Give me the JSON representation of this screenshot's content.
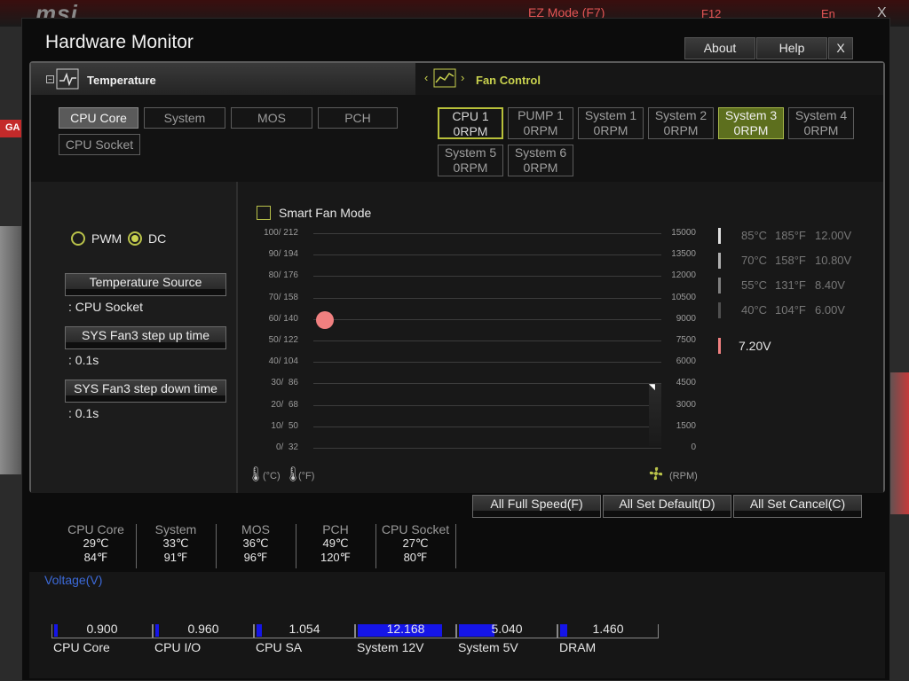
{
  "background": {
    "logo": "msi",
    "ez_mode": "EZ Mode (F7)",
    "f12": "F12",
    "language": "En",
    "close": "X",
    "side_tab": "GA"
  },
  "window": {
    "title": "Hardware Monitor",
    "buttons": {
      "about": "About",
      "help": "Help",
      "close": "X"
    }
  },
  "temperature": {
    "header": "Temperature",
    "sources": [
      "CPU Core",
      "System",
      "MOS",
      "PCH",
      "CPU Socket"
    ],
    "selected": "CPU Core"
  },
  "fan_control": {
    "header": "Fan Control",
    "fans": [
      {
        "name": "CPU 1",
        "rpm": "0RPM"
      },
      {
        "name": "PUMP 1",
        "rpm": "0RPM"
      },
      {
        "name": "System 1",
        "rpm": "0RPM"
      },
      {
        "name": "System 2",
        "rpm": "0RPM"
      },
      {
        "name": "System 3",
        "rpm": "0RPM"
      },
      {
        "name": "System 4",
        "rpm": "0RPM"
      },
      {
        "name": "System 5",
        "rpm": "0RPM"
      },
      {
        "name": "System 6",
        "rpm": "0RPM"
      }
    ],
    "highlighted_fan": "CPU 1",
    "active_fan": "System 3"
  },
  "settings": {
    "mode_pwm": "PWM",
    "mode_dc": "DC",
    "selected_mode": "DC",
    "temp_source_label": "Temperature Source",
    "temp_source_value": ": CPU Socket",
    "step_up_label": "SYS Fan3 step up time",
    "step_up_value": ": 0.1s",
    "step_down_label": "SYS Fan3 step down time",
    "step_down_value": ": 0.1s"
  },
  "graph": {
    "smart_fan_label": "Smart Fan Mode",
    "smart_fan_checked": false,
    "y_left_labels": [
      "100/ 212",
      "90/ 194",
      "80/ 176",
      "70/ 158",
      "60/ 140",
      "50/ 122",
      "40/ 104",
      "30/  86",
      "20/  68",
      "10/  50",
      "0/  32"
    ],
    "y_right_labels": [
      "15000",
      "13500",
      "12000",
      "10500",
      "9000",
      "7500",
      "6000",
      "4500",
      "3000",
      "1500",
      "0"
    ],
    "unit_c": "(°C)",
    "unit_f": "(°F)",
    "unit_rpm": "(RPM)",
    "legend": [
      {
        "c": "85°C",
        "f": "185°F",
        "v": "12.00V",
        "color": "#e0e0e0"
      },
      {
        "c": "70°C",
        "f": "158°F",
        "v": "10.80V",
        "color": "#b0b0b0"
      },
      {
        "c": "55°C",
        "f": "131°F",
        "v": "8.40V",
        "color": "#808080"
      },
      {
        "c": "40°C",
        "f": "104°F",
        "v": "6.00V",
        "color": "#505050"
      }
    ],
    "current_voltage": "7.20V",
    "current_color": "#f08080"
  },
  "actions": {
    "full_speed": "All Full Speed(F)",
    "set_default": "All Set Default(D)",
    "set_cancel": "All Set Cancel(C)"
  },
  "temps": [
    {
      "name": "CPU Core",
      "c": "29℃",
      "f": "84℉"
    },
    {
      "name": "System",
      "c": "33℃",
      "f": "91℉"
    },
    {
      "name": "MOS",
      "c": "36℃",
      "f": "96℉"
    },
    {
      "name": "PCH",
      "c": "49℃",
      "f": "120℉"
    },
    {
      "name": "CPU Socket",
      "c": "27℃",
      "f": "80℉"
    }
  ],
  "voltage": {
    "title": "Voltage(V)",
    "items": [
      {
        "name": "CPU Core",
        "value": "0.900",
        "fill": 0.04
      },
      {
        "name": "CPU I/O",
        "value": "0.960",
        "fill": 0.04
      },
      {
        "name": "CPU SA",
        "value": "1.054",
        "fill": 0.05
      },
      {
        "name": "System 12V",
        "value": "12.168",
        "fill": 0.86
      },
      {
        "name": "System 5V",
        "value": "5.040",
        "fill": 0.36
      },
      {
        "name": "DRAM",
        "value": "1.460",
        "fill": 0.07
      }
    ],
    "bar_color": "#1515e8"
  }
}
